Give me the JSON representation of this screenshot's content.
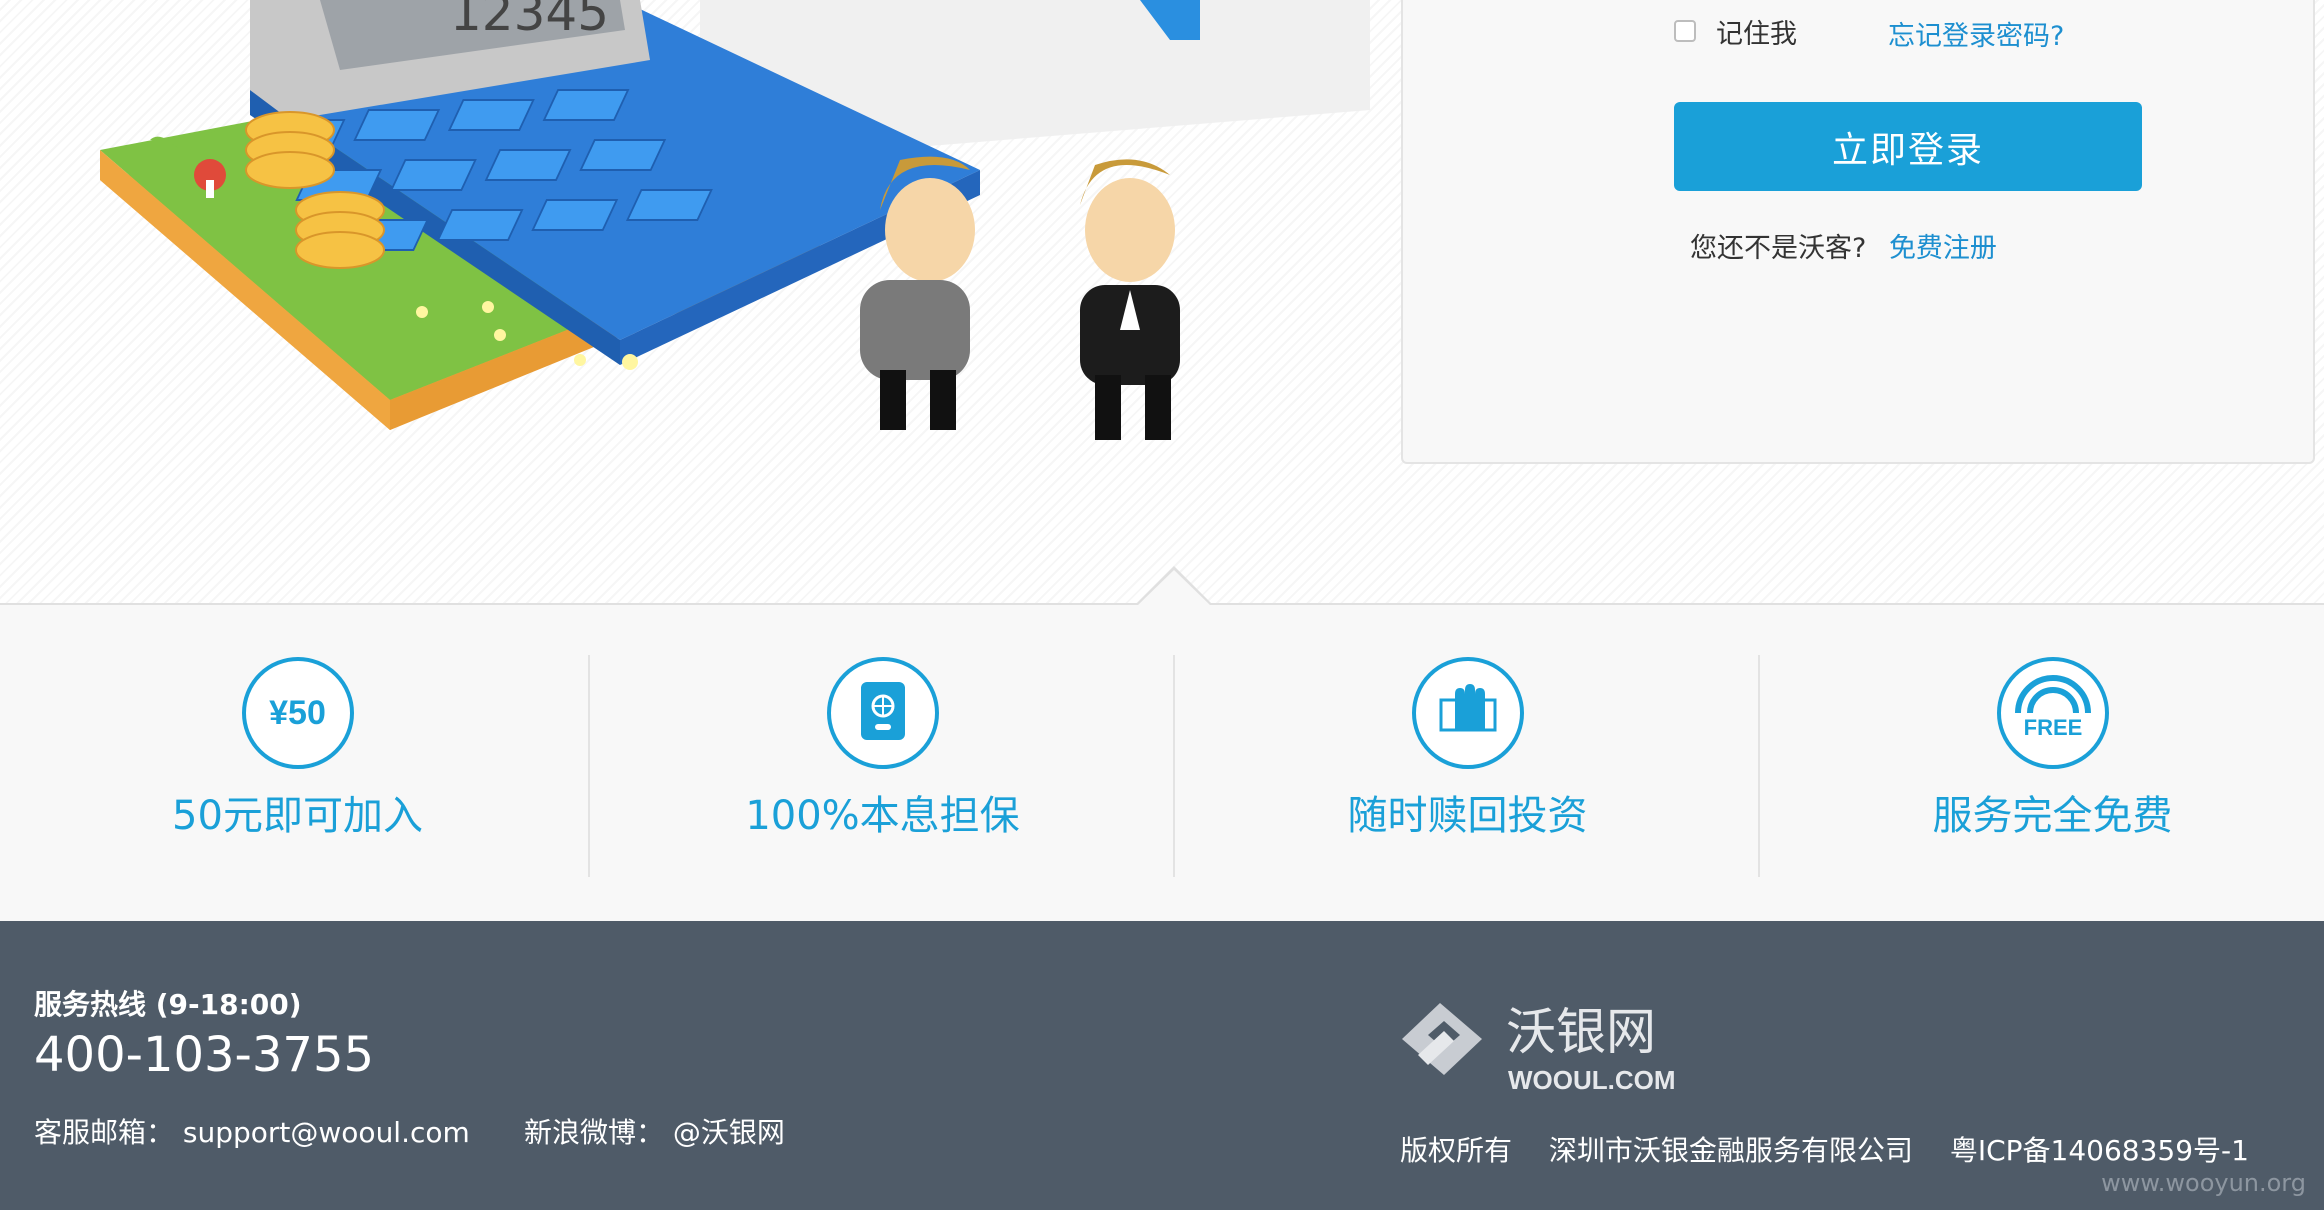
{
  "login": {
    "remember_label": "记住我",
    "forgot_link": "忘记登录密码?",
    "submit_label": "立即登录",
    "register_prompt": "您还不是沃客?",
    "register_link": "免费注册"
  },
  "illustration": {
    "calculator_display": "12345"
  },
  "features": [
    {
      "icon": "yen-50-icon",
      "icon_text": "¥50",
      "label": "50元即可加入"
    },
    {
      "icon": "safe-icon",
      "label": "100%本息担保"
    },
    {
      "icon": "hand-money-icon",
      "label": "随时赎回投资"
    },
    {
      "icon": "free-icon",
      "icon_text": "FREE",
      "label": "服务完全免费"
    }
  ],
  "footer": {
    "hotline_label": "服务热线 (9-18:00)",
    "hotline_number": "400-103-3755",
    "email_line": "客服邮箱： support@wooul.com",
    "weibo_line": "新浪微博： @沃银网",
    "logo_name": "沃银网",
    "logo_domain": "WOOUL.COM",
    "copyright": "版权所有",
    "company": "深圳市沃银金融服务有限公司",
    "icp": "粤ICP备14068359号-1",
    "watermark": "www.wooyun.org"
  },
  "colors": {
    "accent": "#1aa0d8",
    "link": "#1d8fd0",
    "footer_bg": "#4f5b68"
  }
}
